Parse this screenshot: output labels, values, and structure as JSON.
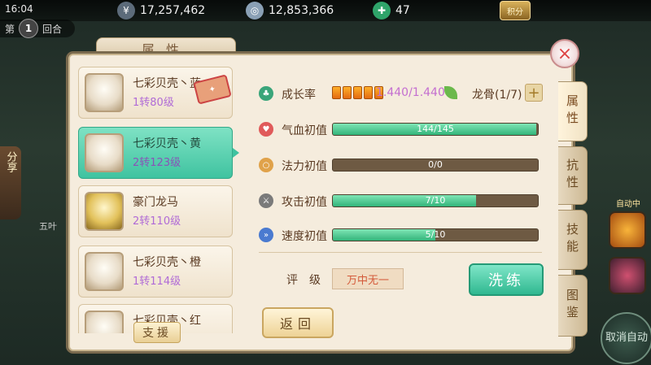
{
  "topbar": {
    "time": "16:04",
    "silver": "17,257,462",
    "gold": "12,853,366",
    "jade": "47",
    "points_label": "积分"
  },
  "battle": {
    "round_prefix": "第",
    "round_num": "1",
    "round_suffix": "回合",
    "share_label": "分享",
    "unit_name": "五叶",
    "auto_label": "自动中",
    "cancel_auto_label": "取消自动"
  },
  "panel": {
    "title": "属性",
    "close_icon": "×",
    "tabs": [
      {
        "label": "属性",
        "active": true
      },
      {
        "label": "抗性",
        "active": false
      },
      {
        "label": "技能",
        "active": false
      },
      {
        "label": "图鉴",
        "active": false
      }
    ]
  },
  "pets": [
    {
      "name": "七彩贝壳丶蓝",
      "level": "1转80级"
    },
    {
      "name": "七彩贝壳丶黄",
      "level": "2转123级",
      "selected": true
    },
    {
      "name": "豪门龙马",
      "level": "2转110级"
    },
    {
      "name": "七彩贝壳丶橙",
      "level": "1转114级"
    },
    {
      "name": "七彩贝壳丶红",
      "level": ""
    }
  ],
  "support_label": "支援",
  "attributes": {
    "growth_label": "成长率",
    "growth_value": "1.440/1.440",
    "dragon_bone": "龙骨(1/7)",
    "plus": "+",
    "stats": [
      {
        "label": "气血初值",
        "text": "144/145",
        "current": 144,
        "max": 145
      },
      {
        "label": "法力初值",
        "text": "0/0",
        "current": 0,
        "max": 0
      },
      {
        "label": "攻击初值",
        "text": "7/10",
        "current": 7,
        "max": 10
      },
      {
        "label": "速度初值",
        "text": "5/10",
        "current": 5,
        "max": 10
      }
    ],
    "rating_label": "评级",
    "rating_value": "万中无一"
  },
  "buttons": {
    "wash": "洗练",
    "back": "返回"
  },
  "colors": {
    "accent": "#3fc3a0",
    "bar_fill": "#32b47a",
    "panel_bg": "#f5ecdd"
  }
}
